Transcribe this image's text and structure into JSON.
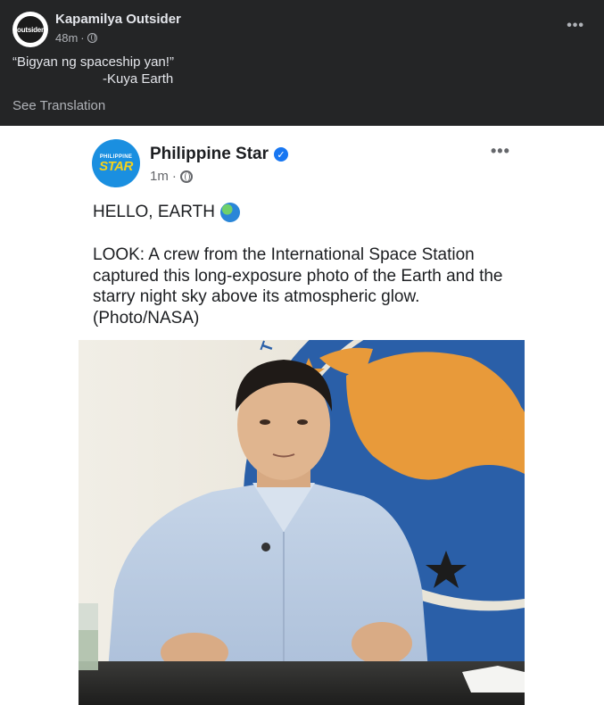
{
  "outer_post": {
    "page_name": "Kapamilya Outsider",
    "avatar_text": "outsider",
    "time": "48m",
    "separator": "·",
    "caption_line1": "“Bigyan ng spaceship yan!”",
    "caption_line2": "-Kuya Earth",
    "see_translation": "See Translation",
    "more_icon": "•••"
  },
  "shared_post": {
    "page_name": "Philippine Star",
    "avatar_top": "PHILIPPINE",
    "avatar_star": "STAR",
    "verified_icon": "✓",
    "time": "1m",
    "separator": "·",
    "more_icon": "•••",
    "headline": "HELLO, EARTH",
    "body": "LOOK: A crew from the International Space Station captured this long-exposure photo of the Earth and the starry night sky above its atmospheric glow. (Photo/NASA)"
  },
  "colors": {
    "dark_bg": "#242526",
    "primary_text_dark": "#e4e6eb",
    "secondary_text_dark": "#b0b3b8",
    "brand_blue": "#1877f2",
    "seal_blue": "#2a5fa8",
    "seal_gold": "#e89a3a"
  }
}
